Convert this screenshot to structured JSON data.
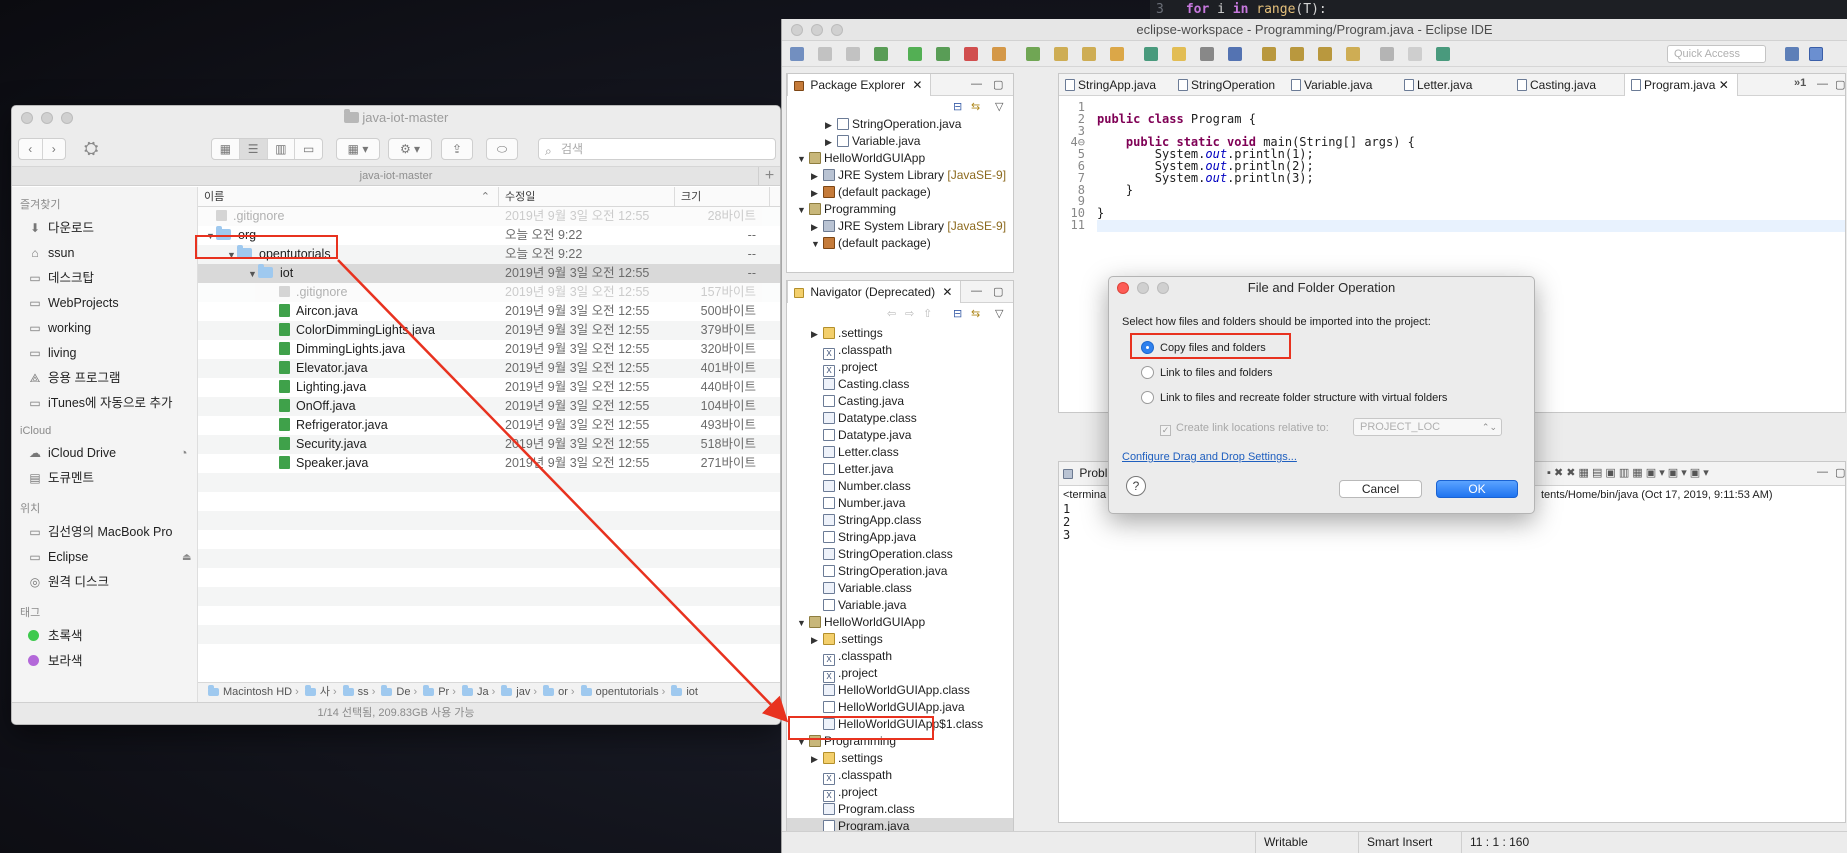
{
  "background": {
    "code_line_number": "3",
    "code_line": {
      "keyword_for": "for",
      "var": " i ",
      "keyword_in": "in",
      "fn": " range",
      "rest": "(T):"
    }
  },
  "finder": {
    "title": "java-iot-master",
    "path_title": "java-iot-master",
    "search_placeholder": "검색",
    "sidebar": {
      "favorites_head": "즐겨찾기",
      "favorites": [
        {
          "label": "다운로드",
          "icon": "download-icon"
        },
        {
          "label": "ssun",
          "icon": "home-icon"
        },
        {
          "label": "데스크탑",
          "icon": "folder-icon"
        },
        {
          "label": "WebProjects",
          "icon": "folder-icon"
        },
        {
          "label": "working",
          "icon": "folder-icon"
        },
        {
          "label": "living",
          "icon": "folder-icon"
        },
        {
          "label": "응용 프로그램",
          "icon": "applications-icon"
        },
        {
          "label": "iTunes에 자동으로 추가",
          "icon": "folder-icon"
        }
      ],
      "icloud_head": "iCloud",
      "icloud": [
        {
          "label": "iCloud Drive",
          "icon": "cloud-icon"
        },
        {
          "label": "도큐멘트",
          "icon": "document-icon"
        }
      ],
      "locations_head": "위치",
      "locations": [
        {
          "label": "김선영의 MacBook Pro",
          "icon": "laptop-icon"
        },
        {
          "label": "Eclipse",
          "icon": "disk-icon"
        },
        {
          "label": "원격 디스크",
          "icon": "disc-icon"
        }
      ],
      "tags_head": "태그",
      "tags": [
        {
          "label": "초록색",
          "color": "#3dc94d"
        },
        {
          "label": "보라색",
          "color": "#b368d9"
        }
      ]
    },
    "columns": {
      "name": "이름",
      "modified": "수정일",
      "size": "크기"
    },
    "rows": [
      {
        "name": ".gitignore",
        "date": "2019년 9월 3일 오전 12:55",
        "size": "28바이트",
        "level": 0,
        "kind": "dim"
      },
      {
        "name": "org",
        "date": "오늘 오전 9:22",
        "size": "--",
        "level": 0,
        "kind": "folder"
      },
      {
        "name": "opentutorials",
        "date": "오늘 오전 9:22",
        "size": "--",
        "level": 1,
        "kind": "folder"
      },
      {
        "name": "iot",
        "date": "2019년 9월 3일 오전 12:55",
        "size": "--",
        "level": 2,
        "kind": "folder-sel"
      },
      {
        "name": ".gitignore",
        "date": "2019년 9월 3일 오전 12:55",
        "size": "157바이트",
        "level": 3,
        "kind": "dim"
      },
      {
        "name": "Aircon.java",
        "date": "2019년 9월 3일 오전 12:55",
        "size": "500바이트",
        "level": 3,
        "kind": "java"
      },
      {
        "name": "ColorDimmingLights.java",
        "date": "2019년 9월 3일 오전 12:55",
        "size": "379바이트",
        "level": 3,
        "kind": "java"
      },
      {
        "name": "DimmingLights.java",
        "date": "2019년 9월 3일 오전 12:55",
        "size": "320바이트",
        "level": 3,
        "kind": "java"
      },
      {
        "name": "Elevator.java",
        "date": "2019년 9월 3일 오전 12:55",
        "size": "401바이트",
        "level": 3,
        "kind": "java"
      },
      {
        "name": "Lighting.java",
        "date": "2019년 9월 3일 오전 12:55",
        "size": "440바이트",
        "level": 3,
        "kind": "java"
      },
      {
        "name": "OnOff.java",
        "date": "2019년 9월 3일 오전 12:55",
        "size": "104바이트",
        "level": 3,
        "kind": "java"
      },
      {
        "name": "Refrigerator.java",
        "date": "2019년 9월 3일 오전 12:55",
        "size": "493바이트",
        "level": 3,
        "kind": "java"
      },
      {
        "name": "Security.java",
        "date": "2019년 9월 3일 오전 12:55",
        "size": "518바이트",
        "level": 3,
        "kind": "java"
      },
      {
        "name": "Speaker.java",
        "date": "2019년 9월 3일 오전 12:55",
        "size": "271바이트",
        "level": 3,
        "kind": "java"
      }
    ],
    "breadcrumbs": [
      "Macintosh HD",
      "사",
      "ss",
      "De",
      "Pr",
      "Ja",
      "jav",
      "or",
      "opentutorials",
      "iot"
    ],
    "status": "1/14 선택됨, 209.83GB 사용 가능"
  },
  "eclipse": {
    "title": "eclipse-workspace - Programming/Program.java - Eclipse IDE",
    "quick_access": "Quick Access",
    "package_explorer": {
      "tab": "Package Explorer",
      "items": [
        {
          "label": "StringOperation.java",
          "indent": 2,
          "icon": "java",
          "twisty": "▶"
        },
        {
          "label": "Variable.java",
          "indent": 2,
          "icon": "java",
          "twisty": "▶"
        },
        {
          "label": "HelloWorldGUIApp",
          "indent": 0,
          "icon": "proj",
          "twisty": "▼"
        },
        {
          "label": "JRE System Library",
          "extra": " [JavaSE-9]",
          "indent": 1,
          "icon": "lib",
          "twisty": "▶"
        },
        {
          "label": "(default package)",
          "indent": 1,
          "icon": "pkg",
          "twisty": "▶"
        },
        {
          "label": "Programming",
          "indent": 0,
          "icon": "proj",
          "twisty": "▼"
        },
        {
          "label": "JRE System Library",
          "extra": " [JavaSE-9]",
          "indent": 1,
          "icon": "lib",
          "twisty": "▶"
        },
        {
          "label": "(default package)",
          "indent": 1,
          "icon": "pkg",
          "twisty": "▼"
        }
      ]
    },
    "navigator": {
      "tab": "Navigator (Deprecated)",
      "items": [
        {
          "label": ".settings",
          "indent": 1,
          "icon": "fold",
          "twisty": "▶"
        },
        {
          "label": ".classpath",
          "indent": 1,
          "icon": "x"
        },
        {
          "label": ".project",
          "indent": 1,
          "icon": "x"
        },
        {
          "label": "Casting.class",
          "indent": 1,
          "icon": "class"
        },
        {
          "label": "Casting.java",
          "indent": 1,
          "icon": "java"
        },
        {
          "label": "Datatype.class",
          "indent": 1,
          "icon": "class"
        },
        {
          "label": "Datatype.java",
          "indent": 1,
          "icon": "java"
        },
        {
          "label": "Letter.class",
          "indent": 1,
          "icon": "class"
        },
        {
          "label": "Letter.java",
          "indent": 1,
          "icon": "java"
        },
        {
          "label": "Number.class",
          "indent": 1,
          "icon": "class"
        },
        {
          "label": "Number.java",
          "indent": 1,
          "icon": "java"
        },
        {
          "label": "StringApp.class",
          "indent": 1,
          "icon": "class"
        },
        {
          "label": "StringApp.java",
          "indent": 1,
          "icon": "java"
        },
        {
          "label": "StringOperation.class",
          "indent": 1,
          "icon": "class"
        },
        {
          "label": "StringOperation.java",
          "indent": 1,
          "icon": "java"
        },
        {
          "label": "Variable.class",
          "indent": 1,
          "icon": "class"
        },
        {
          "label": "Variable.java",
          "indent": 1,
          "icon": "java"
        },
        {
          "label": "HelloWorldGUIApp",
          "indent": 0,
          "icon": "proj",
          "twisty": "▼"
        },
        {
          "label": ".settings",
          "indent": 1,
          "icon": "fold",
          "twisty": "▶"
        },
        {
          "label": ".classpath",
          "indent": 1,
          "icon": "x"
        },
        {
          "label": ".project",
          "indent": 1,
          "icon": "x"
        },
        {
          "label": "HelloWorldGUIApp.class",
          "indent": 1,
          "icon": "class"
        },
        {
          "label": "HelloWorldGUIApp.java",
          "indent": 1,
          "icon": "java"
        },
        {
          "label": "HelloWorldGUIApp$1.class",
          "indent": 1,
          "icon": "class"
        },
        {
          "label": "Programming",
          "indent": 0,
          "icon": "proj",
          "twisty": "▼"
        },
        {
          "label": ".settings",
          "indent": 1,
          "icon": "fold",
          "twisty": "▶"
        },
        {
          "label": ".classpath",
          "indent": 1,
          "icon": "x"
        },
        {
          "label": ".project",
          "indent": 1,
          "icon": "x"
        },
        {
          "label": "Program.class",
          "indent": 1,
          "icon": "class"
        },
        {
          "label": "Program.java",
          "indent": 1,
          "icon": "java",
          "selected": true
        }
      ]
    },
    "editor_tabs": [
      "StringApp.java",
      "StringOperation",
      "Variable.java",
      "Letter.java",
      "Casting.java",
      "Program.java"
    ],
    "editor_overflow": "»1",
    "code": [
      {
        "n": "1",
        "parts": []
      },
      {
        "n": "2",
        "parts": [
          {
            "t": "public class ",
            "c": "kw"
          },
          {
            "t": "Program {",
            "c": ""
          }
        ]
      },
      {
        "n": "3",
        "parts": []
      },
      {
        "n": "4⊖",
        "parts": [
          {
            "t": "    ",
            "c": ""
          },
          {
            "t": "public static void ",
            "c": "kw"
          },
          {
            "t": "main(String[] args) {",
            "c": ""
          }
        ]
      },
      {
        "n": "5",
        "parts": [
          {
            "t": "        System.",
            "c": ""
          },
          {
            "t": "out",
            "c": "fld"
          },
          {
            "t": ".println(1);",
            "c": ""
          }
        ]
      },
      {
        "n": "6",
        "parts": [
          {
            "t": "        System.",
            "c": ""
          },
          {
            "t": "out",
            "c": "fld"
          },
          {
            "t": ".println(2);",
            "c": ""
          }
        ]
      },
      {
        "n": "7",
        "parts": [
          {
            "t": "        System.",
            "c": ""
          },
          {
            "t": "out",
            "c": "fld"
          },
          {
            "t": ".println(3);",
            "c": ""
          }
        ]
      },
      {
        "n": "8",
        "parts": [
          {
            "t": "    }",
            "c": ""
          }
        ]
      },
      {
        "n": "9",
        "parts": []
      },
      {
        "n": "10",
        "parts": [
          {
            "t": "}",
            "c": ""
          }
        ]
      },
      {
        "n": "11",
        "parts": [],
        "current": true
      }
    ],
    "console": {
      "tab": "Probl",
      "header_left": "<termina",
      "header_right": "tents/Home/bin/java (Oct 17, 2019, 9:11:53 AM)",
      "lines": [
        "1",
        "2",
        "3"
      ]
    },
    "status": {
      "writable": "Writable",
      "insert": "Smart Insert",
      "position": "11 : 1 : 160"
    }
  },
  "dialog": {
    "title": "File and Folder Operation",
    "prompt": "Select how files and folders should be imported into the project:",
    "options": [
      "Copy files and folders",
      "Link to files and folders",
      "Link to files and recreate folder structure with virtual folders"
    ],
    "selected": 0,
    "checkbox_label": "Create link locations relative to:",
    "combo_value": "PROJECT_LOC",
    "link": "Configure Drag and Drop Settings...",
    "cancel": "Cancel",
    "ok": "OK"
  },
  "colors": {
    "highlight": "#e8321f",
    "accent": "#2f80ed"
  }
}
